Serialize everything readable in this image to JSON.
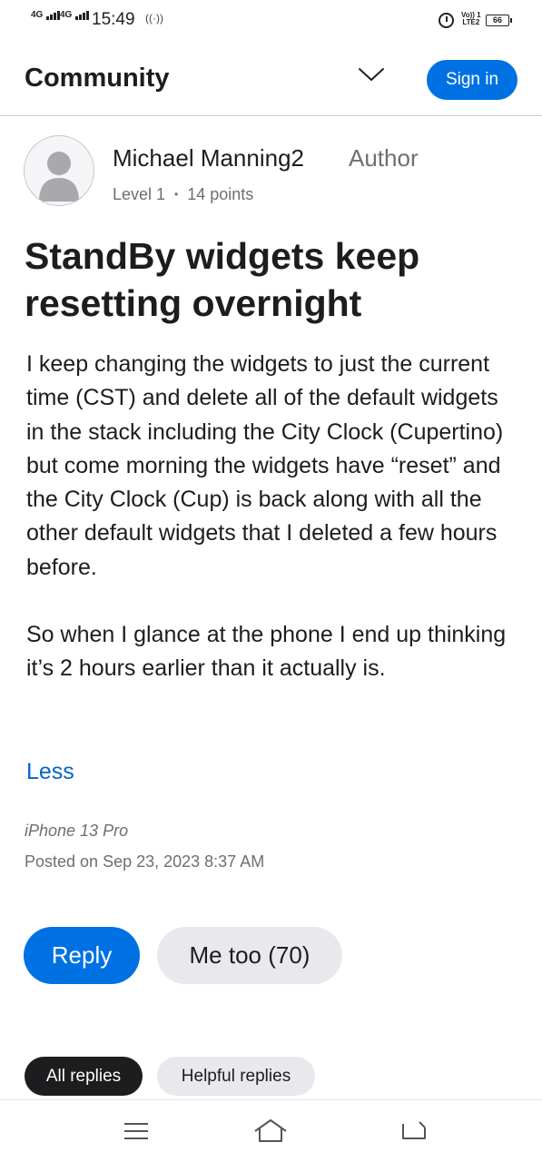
{
  "status_bar": {
    "network1": "4G",
    "network2": "4G",
    "time": "15:49",
    "volte_line1": "Vo)) 1",
    "volte_line2": "LTE2",
    "battery": "66",
    "icons": [
      "signal-icon",
      "hotspot-icon",
      "alarm-icon",
      "battery-icon"
    ]
  },
  "header": {
    "title": "Community",
    "sign_in_label": "Sign in",
    "accent_color": "#0071e3"
  },
  "author": {
    "name": "Michael Manning2",
    "badge": "Author",
    "level": "Level 1",
    "points": "14 points",
    "separator": "•"
  },
  "post": {
    "title": "StandBy widgets keep resetting overnight",
    "paragraph1": "I keep changing the widgets to just the current time (CST) and delete  all of the default widgets in the stack including the City Clock (Cupertino) but come morning the widgets have “reset” and the City Clock (Cup) is back along with all the other default widgets that I deleted a few hours before.",
    "paragraph2": "So when I glance at the phone I end up thinking it’s 2 hours earlier than it actually is.",
    "less_label": "Less",
    "device": "iPhone 13 Pro",
    "posted": "Posted on Sep 23, 2023 8:37 AM"
  },
  "actions": {
    "reply_label": "Reply",
    "me_too_label": "Me too (70)"
  },
  "tabs": {
    "all_label": "All replies",
    "helpful_label": "Helpful replies"
  },
  "nav": {
    "icons": [
      "menu-icon",
      "home-icon",
      "back-icon"
    ]
  }
}
